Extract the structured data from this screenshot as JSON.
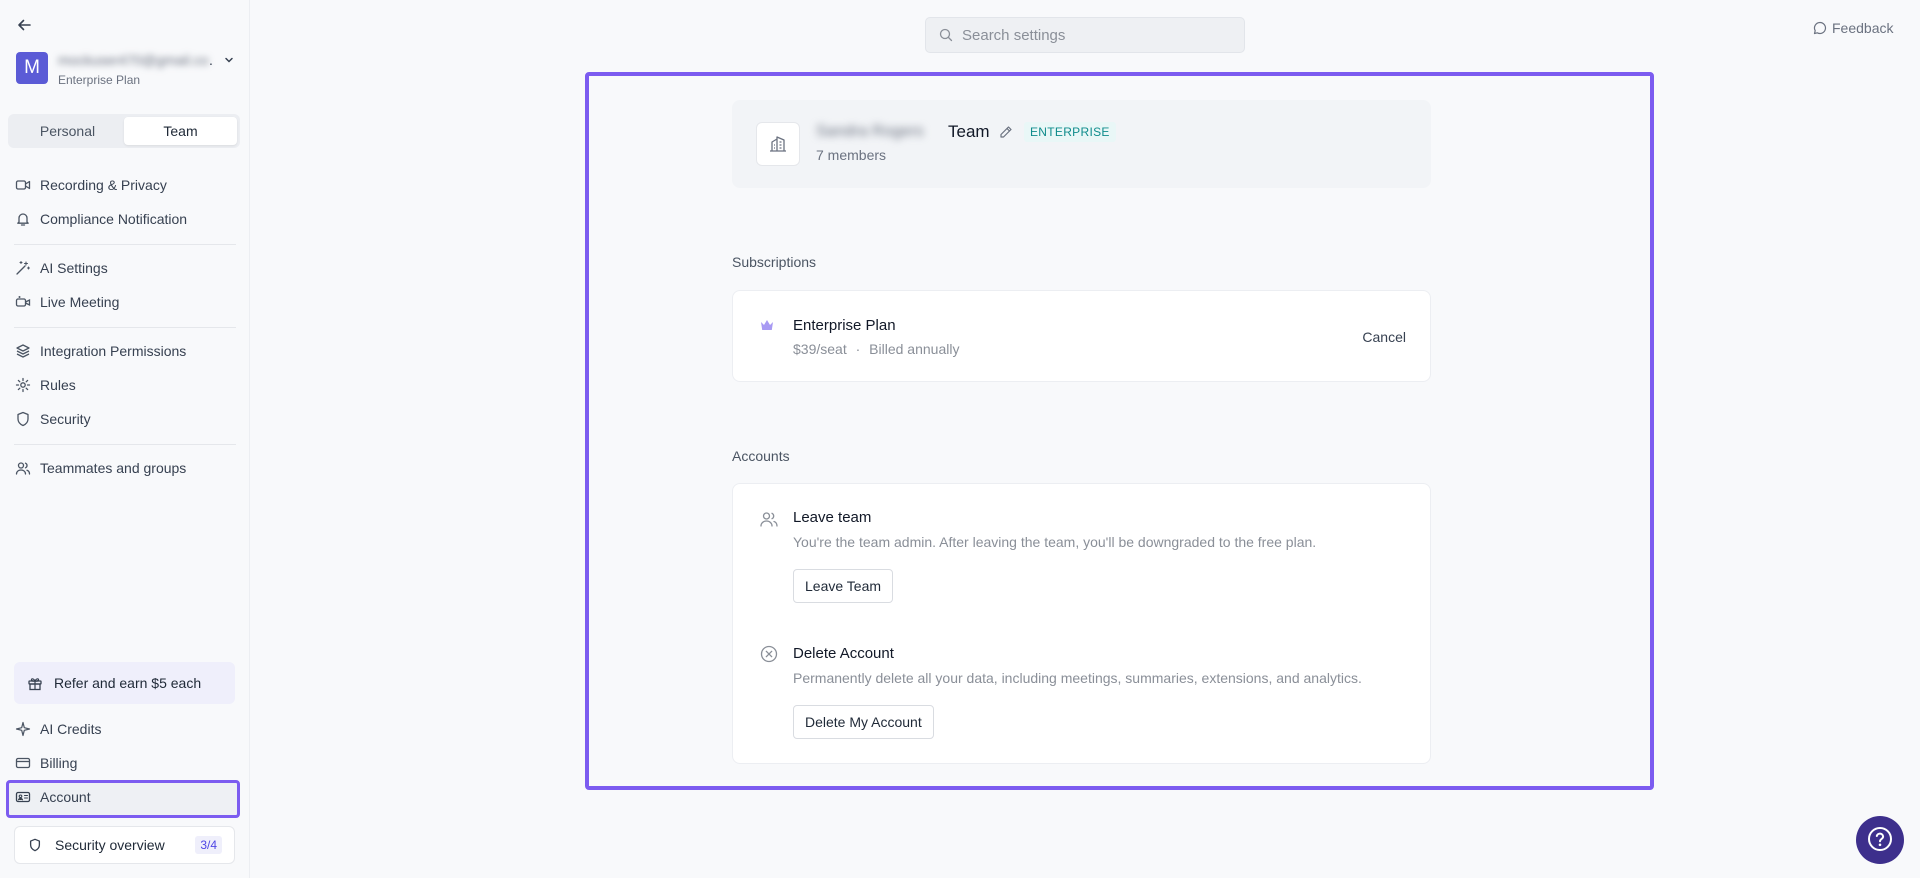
{
  "sidebar": {
    "user": {
      "avatar_letter": "M",
      "email": "mockuser470@gmail.com",
      "dots": ".",
      "plan": "Enterprise Plan"
    },
    "tabs": [
      {
        "label": "Personal",
        "active": false
      },
      {
        "label": "Team",
        "active": true
      }
    ],
    "nav": [
      {
        "label": "Recording & Privacy",
        "icon": "video-icon"
      },
      {
        "label": "Compliance Notification",
        "icon": "bell-icon"
      },
      {
        "label": "AI Settings",
        "icon": "magic-wand-icon"
      },
      {
        "label": "Live Meeting",
        "icon": "live-video-icon"
      },
      {
        "label": "Integration Permissions",
        "icon": "layers-icon"
      },
      {
        "label": "Rules",
        "icon": "gear-icon"
      },
      {
        "label": "Security",
        "icon": "shield-icon"
      },
      {
        "label": "Teammates and groups",
        "icon": "users-icon"
      }
    ],
    "refer_label": "Refer and earn $5 each",
    "bottom_nav": [
      {
        "label": "AI Credits",
        "icon": "sparkle-icon"
      },
      {
        "label": "Billing",
        "icon": "credit-card-icon"
      },
      {
        "label": "Account",
        "icon": "id-card-icon",
        "selected": true
      }
    ],
    "security_overview": {
      "label": "Security overview",
      "badge": "3/4"
    }
  },
  "header": {
    "search_placeholder": "Search settings",
    "feedback_label": "Feedback"
  },
  "team": {
    "name_blurred": "Sandra Rogers",
    "name_suffix": "Team",
    "badge": "ENTERPRISE",
    "members": "7 members"
  },
  "subscriptions": {
    "title": "Subscriptions",
    "plan_name": "Enterprise Plan",
    "price": "$39/seat",
    "separator": "·",
    "billing": "Billed annually",
    "cancel_label": "Cancel"
  },
  "accounts": {
    "title": "Accounts",
    "leave": {
      "title": "Leave team",
      "description": "You're the team admin. After leaving the team, you'll be downgraded to the free plan.",
      "button": "Leave Team"
    },
    "delete": {
      "title": "Delete Account",
      "description": "Permanently delete all your data, including meetings, summaries, extensions, and analytics.",
      "button": "Delete My Account"
    }
  },
  "colors": {
    "accent": "#7c5cf0",
    "avatar": "#5b5bd6",
    "badge_text": "#0f8c8c",
    "help_button": "#3d2f8c"
  }
}
